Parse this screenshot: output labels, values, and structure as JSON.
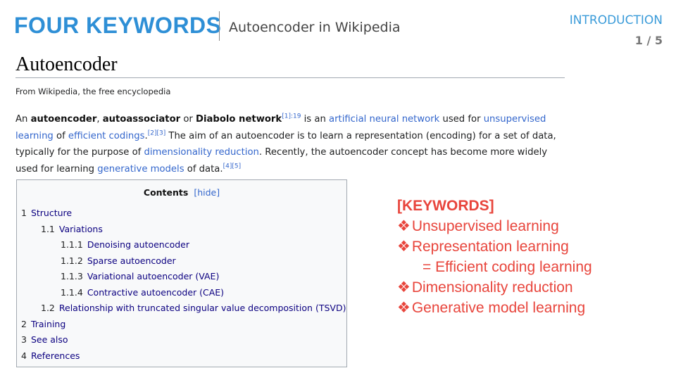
{
  "header": {
    "title": "FOUR KEYWORDS",
    "subtitle": "Autoencoder in Wikipedia",
    "section": "INTRODUCTION",
    "page": "1 / 5"
  },
  "wiki": {
    "heading": "Autoencoder",
    "tagline": "From Wikipedia, the free encyclopedia",
    "para": {
      "p1": "An ",
      "b1": "autoencoder",
      "p2": ", ",
      "b2": "autoassociator",
      "p3": " or ",
      "b3": "Diabolo network",
      "sup1": "[1]:19",
      "p4": " is an ",
      "l1": "artificial neural network",
      "p5": " used for ",
      "l2": "unsupervised learning",
      "p6": " of ",
      "l3": "efficient codings",
      "p7": ".",
      "sup2": "[2][3]",
      "p8": " The aim of an autoencoder is to learn a representation (encoding) for a set of data, typically for the purpose of ",
      "l4": "dimensionality reduction",
      "p9": ". Recently, the autoencoder concept has become more widely used for learning ",
      "l5": "generative models",
      "p10": " of data.",
      "sup3": "[4][5]"
    },
    "toc": {
      "title": "Contents",
      "hide": "[hide]",
      "items": [
        {
          "num": "1",
          "text": "Structure"
        },
        {
          "num": "1.1",
          "text": "Variations"
        },
        {
          "num": "1.1.1",
          "text": "Denoising autoencoder"
        },
        {
          "num": "1.1.2",
          "text": "Sparse autoencoder"
        },
        {
          "num": "1.1.3",
          "text": "Variational autoencoder (VAE)"
        },
        {
          "num": "1.1.4",
          "text": "Contractive autoencoder (CAE)"
        },
        {
          "num": "1.2",
          "text": "Relationship with truncated singular value decomposition (TSVD)"
        },
        {
          "num": "2",
          "text": "Training"
        },
        {
          "num": "3",
          "text": "See also"
        },
        {
          "num": "4",
          "text": "References"
        }
      ]
    }
  },
  "keywords": {
    "heading": "[KEYWORDS]",
    "bullet": "❖",
    "items": [
      "Unsupervised learning",
      "Representation learning",
      "= Efficient coding learning",
      "Dimensionality reduction",
      "Generative model learning"
    ]
  },
  "colors": {
    "title_blue": "#2e8fd6",
    "keyword_red": "#e8453c",
    "link_blue": "#3366cc",
    "toc_link": "#0b0080"
  }
}
